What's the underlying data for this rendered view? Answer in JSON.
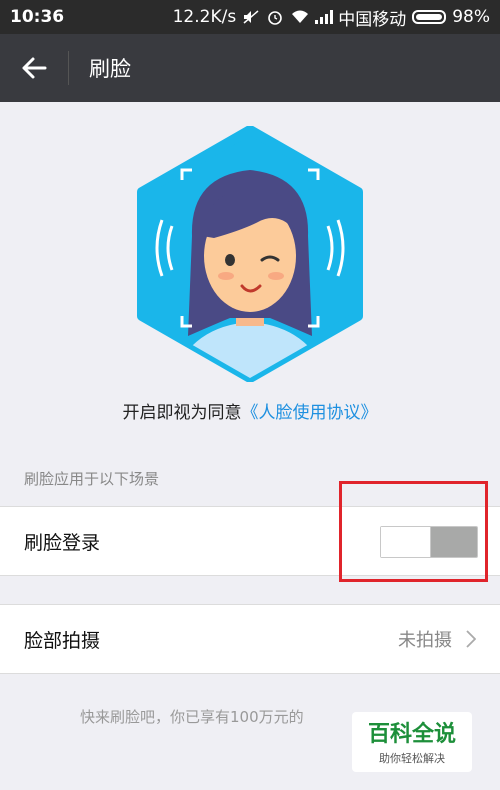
{
  "status_bar": {
    "time": "10:36",
    "speed": "12.2K/s",
    "carrier": "中国移动",
    "battery": "98%"
  },
  "title_bar": {
    "title": "刷脸",
    "back_icon": "back-arrow-icon"
  },
  "agreement": {
    "prefix": "开启即视为同意",
    "link_text": "《人脸使用协议》"
  },
  "section": {
    "label": "刷脸应用于以下场景"
  },
  "rows": {
    "login": {
      "label": "刷脸登录",
      "toggle_on": false
    },
    "photo": {
      "label": "脸部拍摄",
      "status": "未拍摄"
    }
  },
  "footer": {
    "note": "快来刷脸吧，你已享有100万元的"
  },
  "watermark": {
    "main": "百科全说",
    "sub": "助你轻松解决"
  },
  "colors": {
    "hex_blue": "#1ab6ea",
    "link_blue": "#1e90e0",
    "highlight_red": "#e0242b"
  }
}
